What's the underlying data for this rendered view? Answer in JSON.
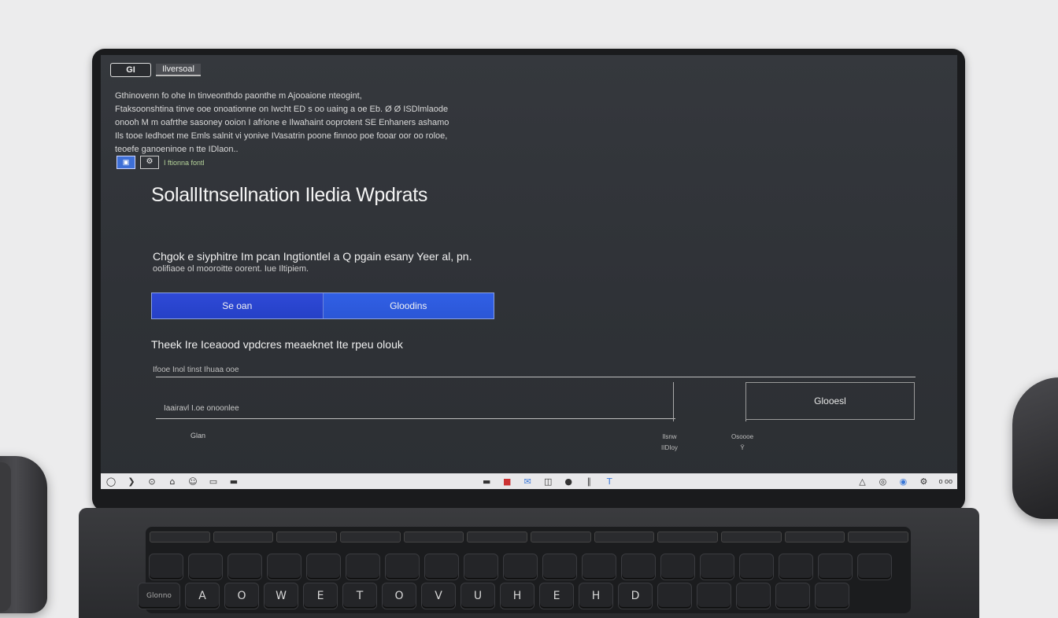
{
  "app": {
    "logo_text": "GI",
    "tab_label": "Ilversoal"
  },
  "intro": {
    "lines": [
      "Gthinovenn fo ohe In tinveonthdo paonthe m Ajooaione nteogint,",
      "Ftaksoonshtina tinve ooe onoationne on Iwcht ED s oo uaing a oe Eb. Ø Ø ISDlmlaode",
      "onooh M m oafrthe sasoney ooion I afrione e Ilwahaint ooprotent SE Enhaners ashamo",
      "Ils tooe Iedhoet me Emls salnit vi yonive IVasatrin poone finnoo poe fooar oor oo roloe,",
      "teoefe ganoeninoe n tte IDlaon.."
    ],
    "lang_label": "I   ftionna fontl"
  },
  "main": {
    "title": "SolallItnsellnation Iledia Wpdrats",
    "subtitle": "Chgok e siyphitre Im pcan Ingtiontlel a Q pgain esany Yeer al, pn.",
    "subdesc": "oolifiaoe ol mooroitte oorent. Iue Iltipiem.",
    "btn_primary": "Se oan",
    "btn_secondary": "Gloodins",
    "section_title": "Theek Ire Iceaood vpdcres meaeknet Ite rpeu olouk",
    "table_head": "Ifooe Inol tinst Ihuaa ooe",
    "row_label": "Iaairavl I.oe onoonlee",
    "action_label": "Glooesl",
    "foot_label": "Glan",
    "meta1": "Ilsnw",
    "meta1b": "IIDIoy",
    "meta2": "Osoooe",
    "meta2b": "Ÿ"
  },
  "taskbar": {
    "icons_left": [
      "start-icon",
      "chevron-icon",
      "pin-icon",
      "lock-icon",
      "face-icon",
      "folder-icon",
      "drive-icon"
    ],
    "icons_center": [
      "flag-icon",
      "mail-icon",
      "camera-icon",
      "record-icon",
      "signal-icon",
      "text-icon"
    ],
    "icons_right": [
      "alert-icon",
      "user-icon",
      "network-icon",
      "volume-icon",
      "settings-icon"
    ],
    "time": "o oo"
  },
  "keyboard": {
    "row1": [
      "Glonno",
      "A",
      "O",
      "W",
      "E",
      "T",
      "O",
      "V",
      "U",
      "H",
      "E",
      "H",
      "D"
    ]
  }
}
